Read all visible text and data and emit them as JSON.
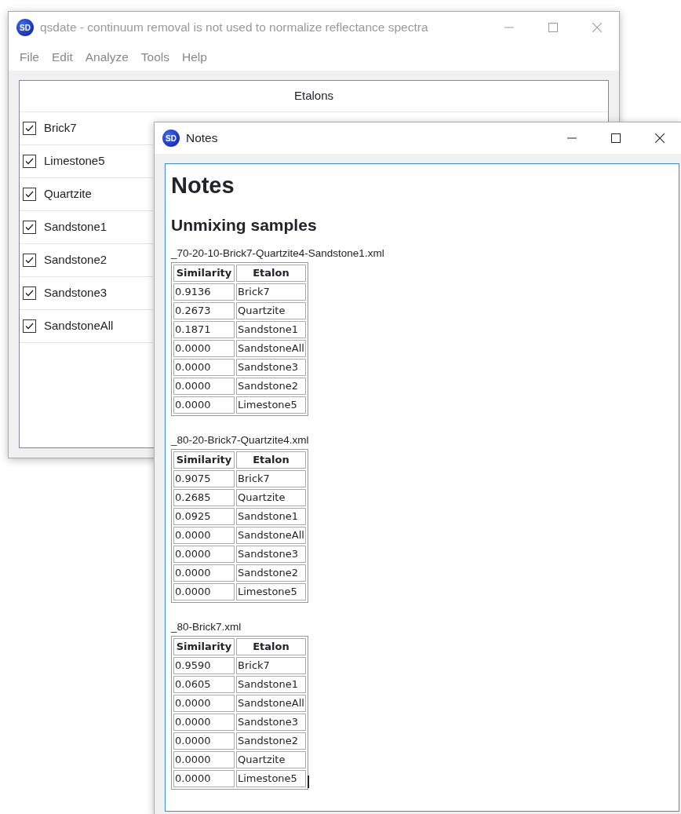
{
  "main_window": {
    "app_icon_label": "SD",
    "title": "qsdate - continuum removal is not used to normalize reflectance spectra",
    "active": false,
    "menu": [
      "File",
      "Edit",
      "Analyze",
      "Tools",
      "Help"
    ],
    "list": {
      "header": "Etalons",
      "items": [
        {
          "label": "Brick7",
          "checked": true
        },
        {
          "label": "Limestone5",
          "checked": true
        },
        {
          "label": "Quartzite",
          "checked": true
        },
        {
          "label": "Sandstone1",
          "checked": true
        },
        {
          "label": "Sandstone2",
          "checked": true
        },
        {
          "label": "Sandstone3",
          "checked": true
        },
        {
          "label": "SandstoneAll",
          "checked": true
        }
      ]
    }
  },
  "notes_window": {
    "app_icon_label": "SD",
    "title": "Notes",
    "active": true,
    "heading": "Notes",
    "subheading": "Unmixing samples",
    "samples": [
      {
        "file": "_70-20-10-Brick7-Quartzite4-Sandstone1.xml",
        "columns": [
          "Similarity",
          "Etalon"
        ],
        "rows": [
          [
            "0.9136",
            "Brick7"
          ],
          [
            "0.2673",
            "Quartzite"
          ],
          [
            "0.1871",
            "Sandstone1"
          ],
          [
            "0.0000",
            "SandstoneAll"
          ],
          [
            "0.0000",
            "Sandstone3"
          ],
          [
            "0.0000",
            "Sandstone2"
          ],
          [
            "0.0000",
            "Limestone5"
          ]
        ]
      },
      {
        "file": "_80-20-Brick7-Quartzite4.xml",
        "columns": [
          "Similarity",
          "Etalon"
        ],
        "rows": [
          [
            "0.9075",
            "Brick7"
          ],
          [
            "0.2685",
            "Quartzite"
          ],
          [
            "0.0925",
            "Sandstone1"
          ],
          [
            "0.0000",
            "SandstoneAll"
          ],
          [
            "0.0000",
            "Sandstone3"
          ],
          [
            "0.0000",
            "Sandstone2"
          ],
          [
            "0.0000",
            "Limestone5"
          ]
        ]
      },
      {
        "file": "_80-Brick7.xml",
        "columns": [
          "Similarity",
          "Etalon"
        ],
        "rows": [
          [
            "0.9590",
            "Brick7"
          ],
          [
            "0.0605",
            "Sandstone1"
          ],
          [
            "0.0000",
            "SandstoneAll"
          ],
          [
            "0.0000",
            "Sandstone3"
          ],
          [
            "0.0000",
            "Sandstone2"
          ],
          [
            "0.0000",
            "Quartzite"
          ],
          [
            "0.0000",
            "Limestone5"
          ]
        ],
        "text_cursor": true
      }
    ]
  }
}
